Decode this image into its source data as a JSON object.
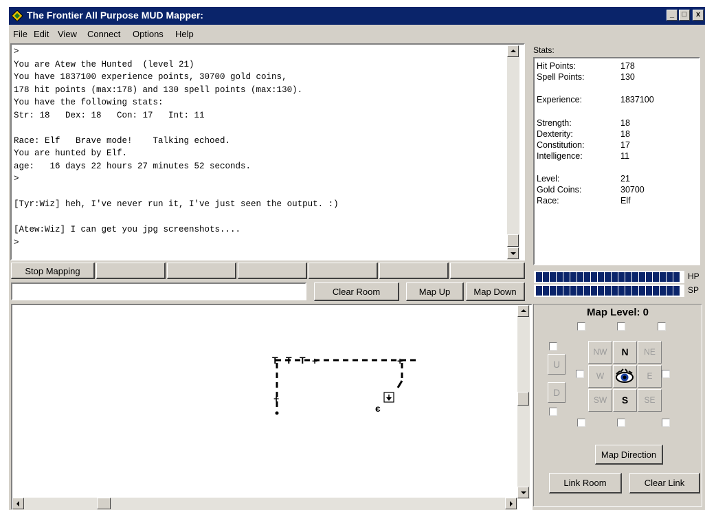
{
  "window": {
    "title": "The Frontier All Purpose MUD Mapper:",
    "controls": [
      "_",
      "□",
      "x"
    ]
  },
  "menu": [
    "File",
    "Edit",
    "View",
    "Connect",
    "Options",
    "Help"
  ],
  "console": {
    "lines": [
      ">",
      "You are Atew the Hunted  (level 21)",
      "You have 1837100 experience points, 30700 gold coins,",
      "178 hit points (max:178) and 130 spell points (max:130).",
      "You have the following stats:",
      "Str: 18   Dex: 18   Con: 17   Int: 11",
      "",
      "Race: Elf   Brave mode!    Talking echoed.",
      "You are hunted by Elf.",
      "age:   16 days 22 hours 27 minutes 52 seconds.",
      ">",
      "",
      "[Tyr:Wiz] heh, I've never run it, I've just seen the output. :)",
      "",
      "[Atew:Wiz] I can get you jpg screenshots....",
      ">"
    ]
  },
  "toolbar": {
    "stop_mapping": "Stop Mapping",
    "clear_room": "Clear Room",
    "map_up": "Map Up",
    "map_down": "Map Down",
    "command_value": ""
  },
  "stats": {
    "label": "Stats:",
    "rows": [
      {
        "label": "Hit Points:",
        "value": "178"
      },
      {
        "label": "Spell Points:",
        "value": "130"
      },
      {
        "label": "Experience:",
        "value": "1837100"
      },
      {
        "label": "Strength:",
        "value": "18"
      },
      {
        "label": "Dexterity:",
        "value": "18"
      },
      {
        "label": "Constitution:",
        "value": "17"
      },
      {
        "label": "Intelligence:",
        "value": "11"
      },
      {
        "label": "Level:",
        "value": "21"
      },
      {
        "label": "Gold Coins:",
        "value": "30700"
      },
      {
        "label": "Race:",
        "value": "Elf"
      }
    ]
  },
  "meters": {
    "hp_label": "HP",
    "sp_label": "SP",
    "hp_fraction": 1.0,
    "sp_fraction": 1.0,
    "color": "#0a246a"
  },
  "map_panel": {
    "level_label": "Map Level: 0",
    "up": "U",
    "down": "D",
    "nw": "NW",
    "n": "N",
    "ne": "NE",
    "w": "W",
    "e": "E",
    "sw": "SW",
    "s": "S",
    "se": "SE",
    "map_direction": "Map Direction",
    "link_room": "Link Room",
    "clear_link": "Clear Link"
  }
}
